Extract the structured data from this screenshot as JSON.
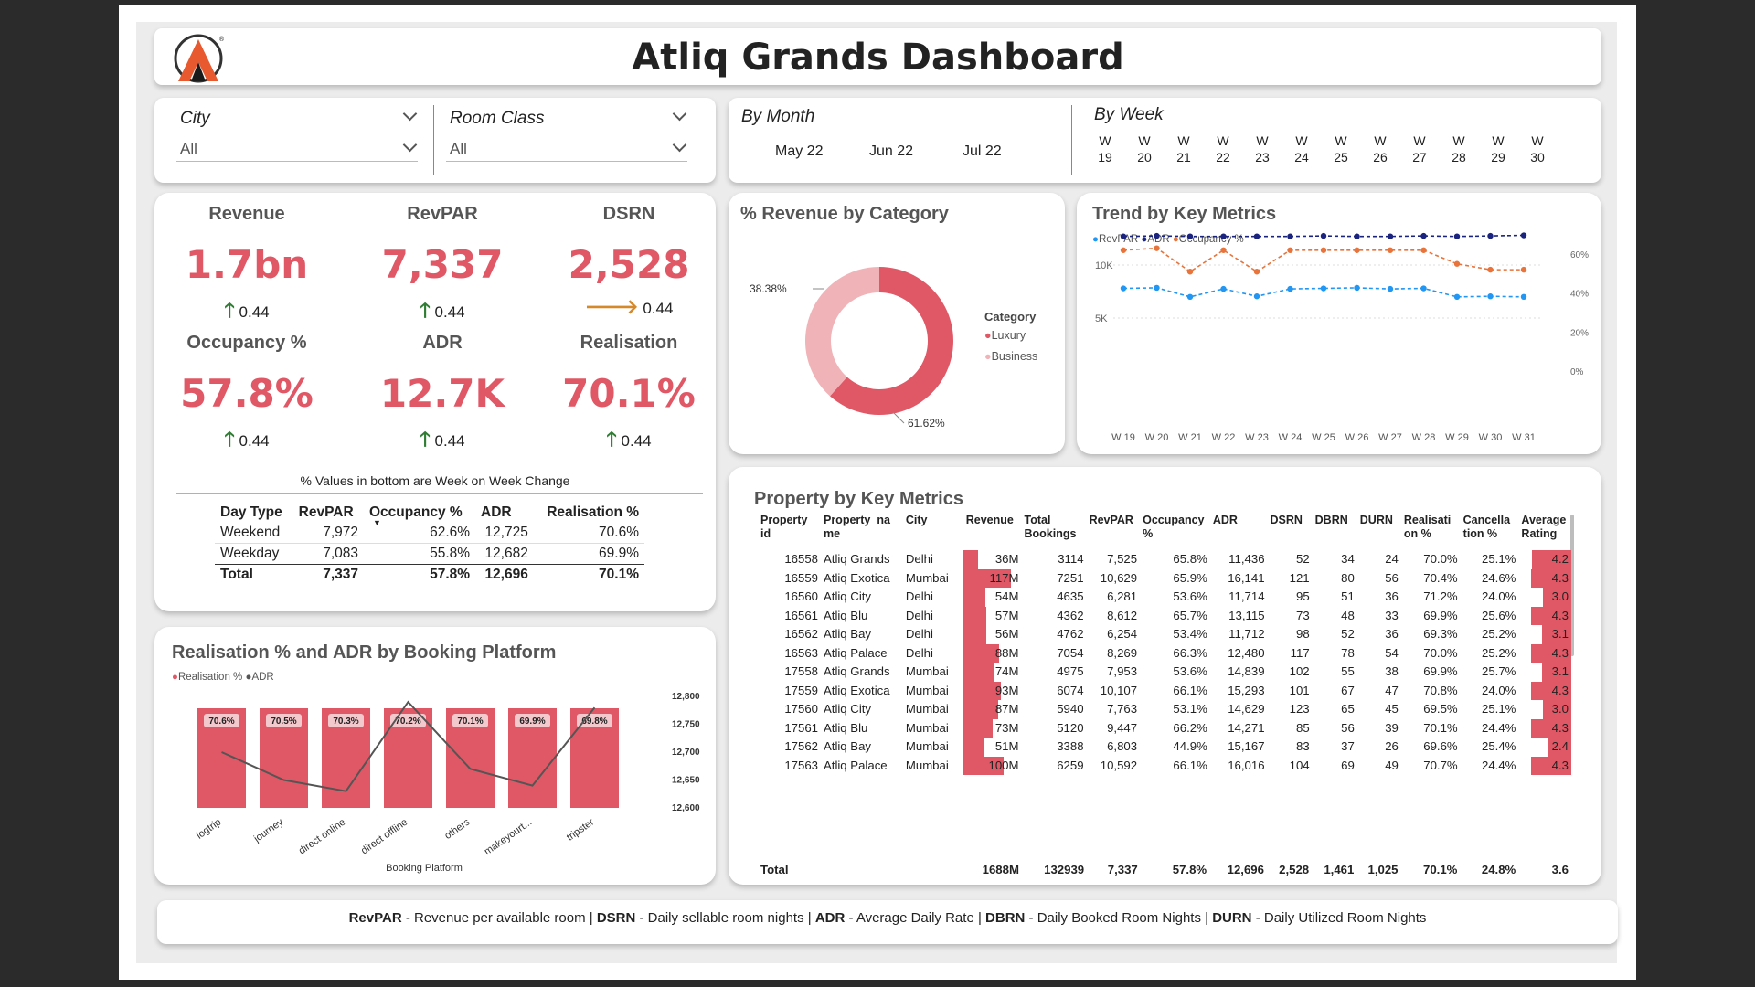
{
  "header": {
    "title": "Atliq Grands Dashboard"
  },
  "filters": {
    "city": {
      "label": "City",
      "value": "All"
    },
    "room_class": {
      "label": "Room Class",
      "value": "All"
    },
    "month": {
      "label": "By Month",
      "options": [
        "May 22",
        "Jun 22",
        "Jul 22"
      ]
    },
    "week": {
      "label": "By Week",
      "options": [
        [
          "W",
          "19"
        ],
        [
          "W",
          "20"
        ],
        [
          "W",
          "21"
        ],
        [
          "W",
          "22"
        ],
        [
          "W",
          "23"
        ],
        [
          "W",
          "24"
        ],
        [
          "W",
          "25"
        ],
        [
          "W",
          "26"
        ],
        [
          "W",
          "27"
        ],
        [
          "W",
          "28"
        ],
        [
          "W",
          "29"
        ],
        [
          "W",
          "30"
        ]
      ]
    }
  },
  "kpis": [
    {
      "name": "Revenue",
      "value": "1.7bn",
      "change": "0.44",
      "trend": "up"
    },
    {
      "name": "RevPAR",
      "value": "7,337",
      "change": "0.44",
      "trend": "up"
    },
    {
      "name": "DSRN",
      "value": "2,528",
      "change": "0.44",
      "trend": "flat"
    },
    {
      "name": "Occupancy %",
      "value": "57.8%",
      "change": "0.44",
      "trend": "up"
    },
    {
      "name": "ADR",
      "value": "12.7K",
      "change": "0.44",
      "trend": "up"
    },
    {
      "name": "Realisation",
      "value": "70.1%",
      "change": "0.44",
      "trend": "up"
    }
  ],
  "kpi_note": "% Values in bottom are Week on Week Change",
  "day_type_table": {
    "headers": [
      "Day Type",
      "RevPAR",
      "Occupancy %",
      "ADR",
      "Realisation %"
    ],
    "rows": [
      [
        "Weekend",
        "7,972",
        "62.6%",
        "12,725",
        "70.6%"
      ],
      [
        "Weekday",
        "7,083",
        "55.8%",
        "12,682",
        "69.9%"
      ]
    ],
    "total": [
      "Total",
      "7,337",
      "57.8%",
      "12,696",
      "70.1%"
    ]
  },
  "donut": {
    "title": "% Revenue by Category",
    "legend_title": "Category",
    "labels": [
      "38.38%",
      "61.62%"
    ]
  },
  "trend": {
    "title": "Trend by Key Metrics",
    "legend": [
      "RevPAR",
      "ADR",
      "Occupancy %"
    ],
    "left_ticks": [
      "10K",
      "5K"
    ],
    "right_ticks": [
      "60%",
      "40%",
      "20%",
      "0%"
    ]
  },
  "booking": {
    "title": "Realisation % and ADR by Booking Platform",
    "legend": [
      "Realisation %",
      "ADR"
    ],
    "xlabel": "Booking Platform",
    "right_ticks": [
      "12,800",
      "12,750",
      "12,700",
      "12,650",
      "12,600"
    ],
    "bar_labels": [
      "70.6%",
      "70.5%",
      "70.3%",
      "70.2%",
      "70.1%",
      "69.9%",
      "69.8%"
    ]
  },
  "property": {
    "title": "Property by Key Metrics",
    "headers": [
      "Property_\nid",
      "Property_na\nme",
      "City",
      "Revenue",
      "Total\nBookings",
      "RevPAR",
      "Occupancy\n%",
      "ADR",
      "DSRN",
      "DBRN",
      "DURN",
      "Realisati\non %",
      "Cancella\ntion %",
      "Average\nRating"
    ],
    "rows": [
      [
        "16558",
        "Atliq Grands",
        "Delhi",
        "36M",
        "3114",
        "7,525",
        "65.8%",
        "11,436",
        "52",
        "34",
        "24",
        "70.0%",
        "25.1%",
        "4.2"
      ],
      [
        "16559",
        "Atliq Exotica",
        "Mumbai",
        "117M",
        "7251",
        "10,629",
        "65.9%",
        "16,141",
        "121",
        "80",
        "56",
        "70.4%",
        "24.6%",
        "4.3"
      ],
      [
        "16560",
        "Atliq City",
        "Delhi",
        "54M",
        "4635",
        "6,281",
        "53.6%",
        "11,714",
        "95",
        "51",
        "36",
        "71.2%",
        "24.0%",
        "3.0"
      ],
      [
        "16561",
        "Atliq Blu",
        "Delhi",
        "57M",
        "4362",
        "8,612",
        "65.7%",
        "13,115",
        "73",
        "48",
        "33",
        "69.9%",
        "25.6%",
        "4.3"
      ],
      [
        "16562",
        "Atliq Bay",
        "Delhi",
        "56M",
        "4762",
        "6,254",
        "53.4%",
        "11,712",
        "98",
        "52",
        "36",
        "69.3%",
        "25.2%",
        "3.1"
      ],
      [
        "16563",
        "Atliq Palace",
        "Delhi",
        "88M",
        "7054",
        "8,269",
        "66.3%",
        "12,480",
        "117",
        "78",
        "54",
        "70.0%",
        "25.2%",
        "4.3"
      ],
      [
        "17558",
        "Atliq Grands",
        "Mumbai",
        "74M",
        "4975",
        "7,953",
        "53.6%",
        "14,839",
        "102",
        "55",
        "38",
        "69.9%",
        "25.7%",
        "3.1"
      ],
      [
        "17559",
        "Atliq Exotica",
        "Mumbai",
        "93M",
        "6074",
        "10,107",
        "66.1%",
        "15,293",
        "101",
        "67",
        "47",
        "70.8%",
        "24.0%",
        "4.3"
      ],
      [
        "17560",
        "Atliq City",
        "Mumbai",
        "87M",
        "5940",
        "7,763",
        "53.1%",
        "14,629",
        "123",
        "65",
        "45",
        "69.5%",
        "25.1%",
        "3.0"
      ],
      [
        "17561",
        "Atliq Blu",
        "Mumbai",
        "73M",
        "5120",
        "9,447",
        "66.2%",
        "14,271",
        "85",
        "56",
        "39",
        "70.1%",
        "24.4%",
        "4.3"
      ],
      [
        "17562",
        "Atliq Bay",
        "Mumbai",
        "51M",
        "3388",
        "6,803",
        "44.9%",
        "15,167",
        "83",
        "37",
        "26",
        "69.6%",
        "25.4%",
        "2.4"
      ],
      [
        "17563",
        "Atliq Palace",
        "Mumbai",
        "100M",
        "6259",
        "10,592",
        "66.1%",
        "16,016",
        "104",
        "69",
        "49",
        "70.7%",
        "24.4%",
        "4.3"
      ]
    ],
    "total": [
      "Total",
      "",
      "",
      "1688M",
      "132939",
      "7,337",
      "57.8%",
      "12,696",
      "2,528",
      "1,461",
      "1,025",
      "70.1%",
      "24.8%",
      "3.6"
    ]
  },
  "footer": {
    "items": [
      [
        "RevPAR",
        " - Revenue per available room | "
      ],
      [
        "DSRN",
        " - Daily sellable room nights | "
      ],
      [
        "ADR",
        " - Average Daily Rate | "
      ],
      [
        "DBRN",
        " - Daily Booked Room Nights | "
      ],
      [
        "DURN",
        " - Daily Utilized Room Nights"
      ]
    ]
  },
  "colors": {
    "accent": "#e05866",
    "light": "#f0b3b8",
    "adr_dark": "#1a237e",
    "revpar_blue": "#2196f3",
    "occ_orange": "#e8743b"
  },
  "chart_data": [
    {
      "type": "pie",
      "title": "% Revenue by Category",
      "categories": [
        "Luxury",
        "Business"
      ],
      "values": [
        61.62,
        38.38
      ],
      "legend": "right"
    },
    {
      "type": "line",
      "title": "Trend by Key Metrics",
      "x": [
        "W 19",
        "W 20",
        "W 21",
        "W 22",
        "W 23",
        "W 24",
        "W 25",
        "W 26",
        "W 27",
        "W 28",
        "W 29",
        "W 30",
        "W 31"
      ],
      "series": [
        {
          "name": "RevPAR",
          "values": [
            7800,
            7850,
            7000,
            7750,
            7050,
            7750,
            7800,
            7850,
            7750,
            7800,
            7000,
            7050,
            7000
          ]
        },
        {
          "name": "ADR",
          "values": [
            12700,
            12750,
            12700,
            12700,
            12700,
            12700,
            12750,
            12700,
            12700,
            12750,
            12700,
            12750,
            12800
          ]
        },
        {
          "name": "Occupancy %",
          "values": [
            62,
            63,
            51,
            62,
            51,
            62,
            62,
            62,
            62,
            62,
            55,
            52,
            52
          ]
        }
      ],
      "ylim_left": [
        0,
        12500
      ],
      "ylim_right": [
        0,
        68
      ],
      "legend": "top-left"
    },
    {
      "type": "bar",
      "title": "Realisation % and ADR by Booking Platform",
      "categories": [
        "logtrip",
        "journey",
        "direct online",
        "direct offline",
        "others",
        "makeyourt...",
        "tripster"
      ],
      "series": [
        {
          "name": "Realisation %",
          "values": [
            70.6,
            70.5,
            70.3,
            70.2,
            70.1,
            69.9,
            69.8
          ]
        },
        {
          "name": "ADR",
          "values": [
            12700,
            12650,
            12630,
            12790,
            12670,
            12640,
            12780
          ]
        }
      ],
      "xlabel": "Booking Platform",
      "ylim_right": [
        12600,
        12800
      ],
      "legend": "top-left"
    }
  ]
}
